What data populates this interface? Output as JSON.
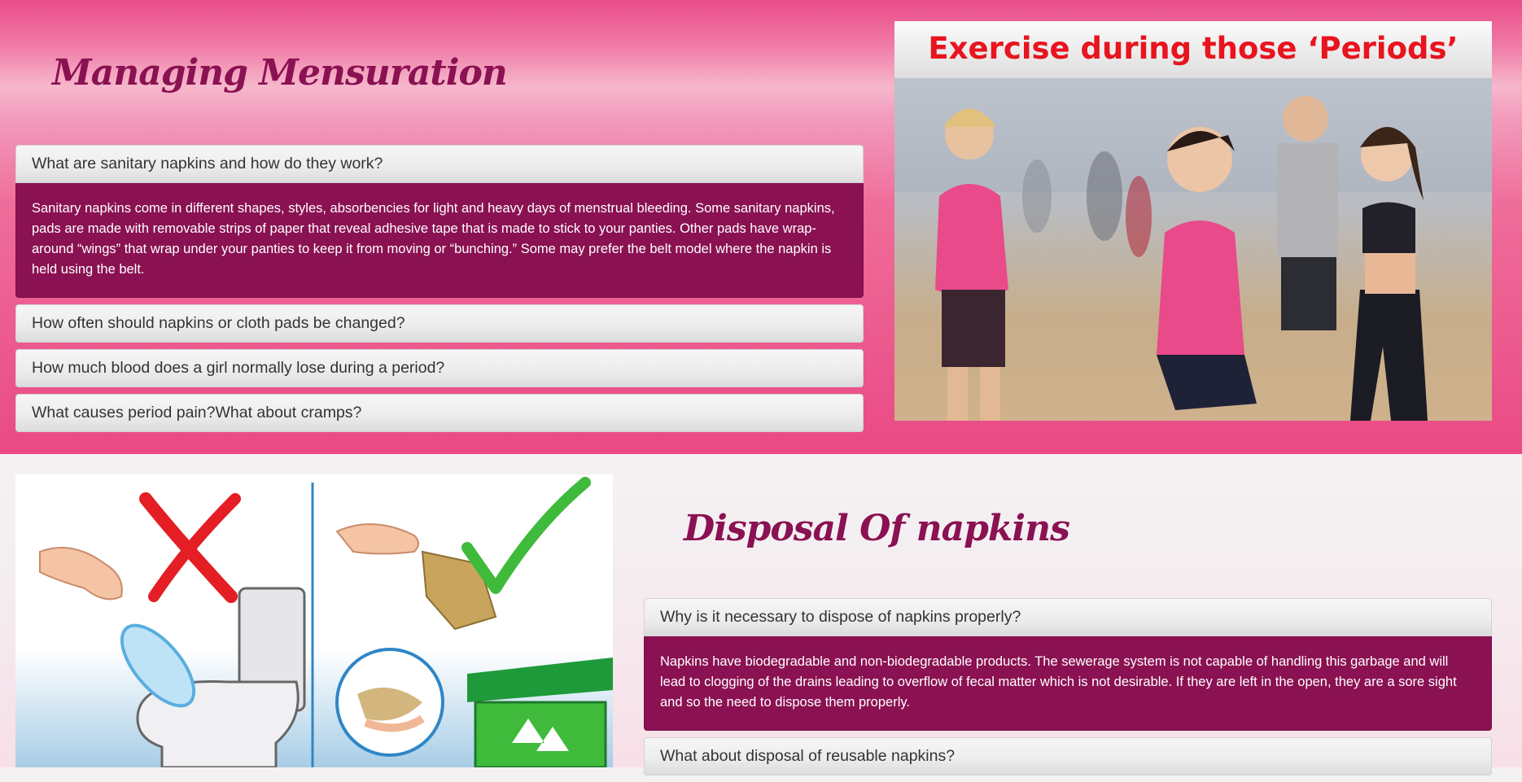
{
  "section_managing": {
    "title": "Managing Mensuration",
    "accordion": [
      {
        "question": "What are sanitary napkins and how do they work?",
        "answer": "Sanitary napkins come in different shapes, styles, absorbencies for light and heavy days of menstrual bleeding. Some sanitary napkins, pads are made with removable strips of paper that reveal adhesive tape that is made to stick to your panties. Other pads have wrap-around “wings” that wrap under your panties to keep it from moving or “bunching.” Some may prefer the belt model where the napkin is held using the belt."
      },
      {
        "question": "How often should napkins or cloth pads be changed?"
      },
      {
        "question": "How much blood does a girl normally lose during a period?"
      },
      {
        "question": "What causes period pain?What about cramps?"
      }
    ],
    "image": {
      "caption": "Exercise during those ‘Periods’",
      "caption_color": "#e8141e"
    }
  },
  "section_disposal": {
    "title": "Disposal Of napkins",
    "accordion": [
      {
        "question": "Why is it necessary to dispose of napkins properly?",
        "answer": "Napkins have biodegradable and non-biodegradable products. The sewerage system is not capable of handling this garbage and will lead to clogging of the drains leading to overflow of fecal matter which is not desirable. If they are left in the open, they are a sore sight and so the need to dispose them properly."
      },
      {
        "question": "What about disposal of reusable napkins?"
      }
    ],
    "image": {
      "icons": [
        "cross-mark-icon",
        "check-mark-icon",
        "toilet-icon",
        "recycle-bin-icon",
        "sanitary-pad-icon",
        "paper-wrap-icon"
      ]
    }
  },
  "colors": {
    "accent": "#8a1152",
    "pink": "#ea4c89",
    "answer_bg": "#8a1152"
  }
}
